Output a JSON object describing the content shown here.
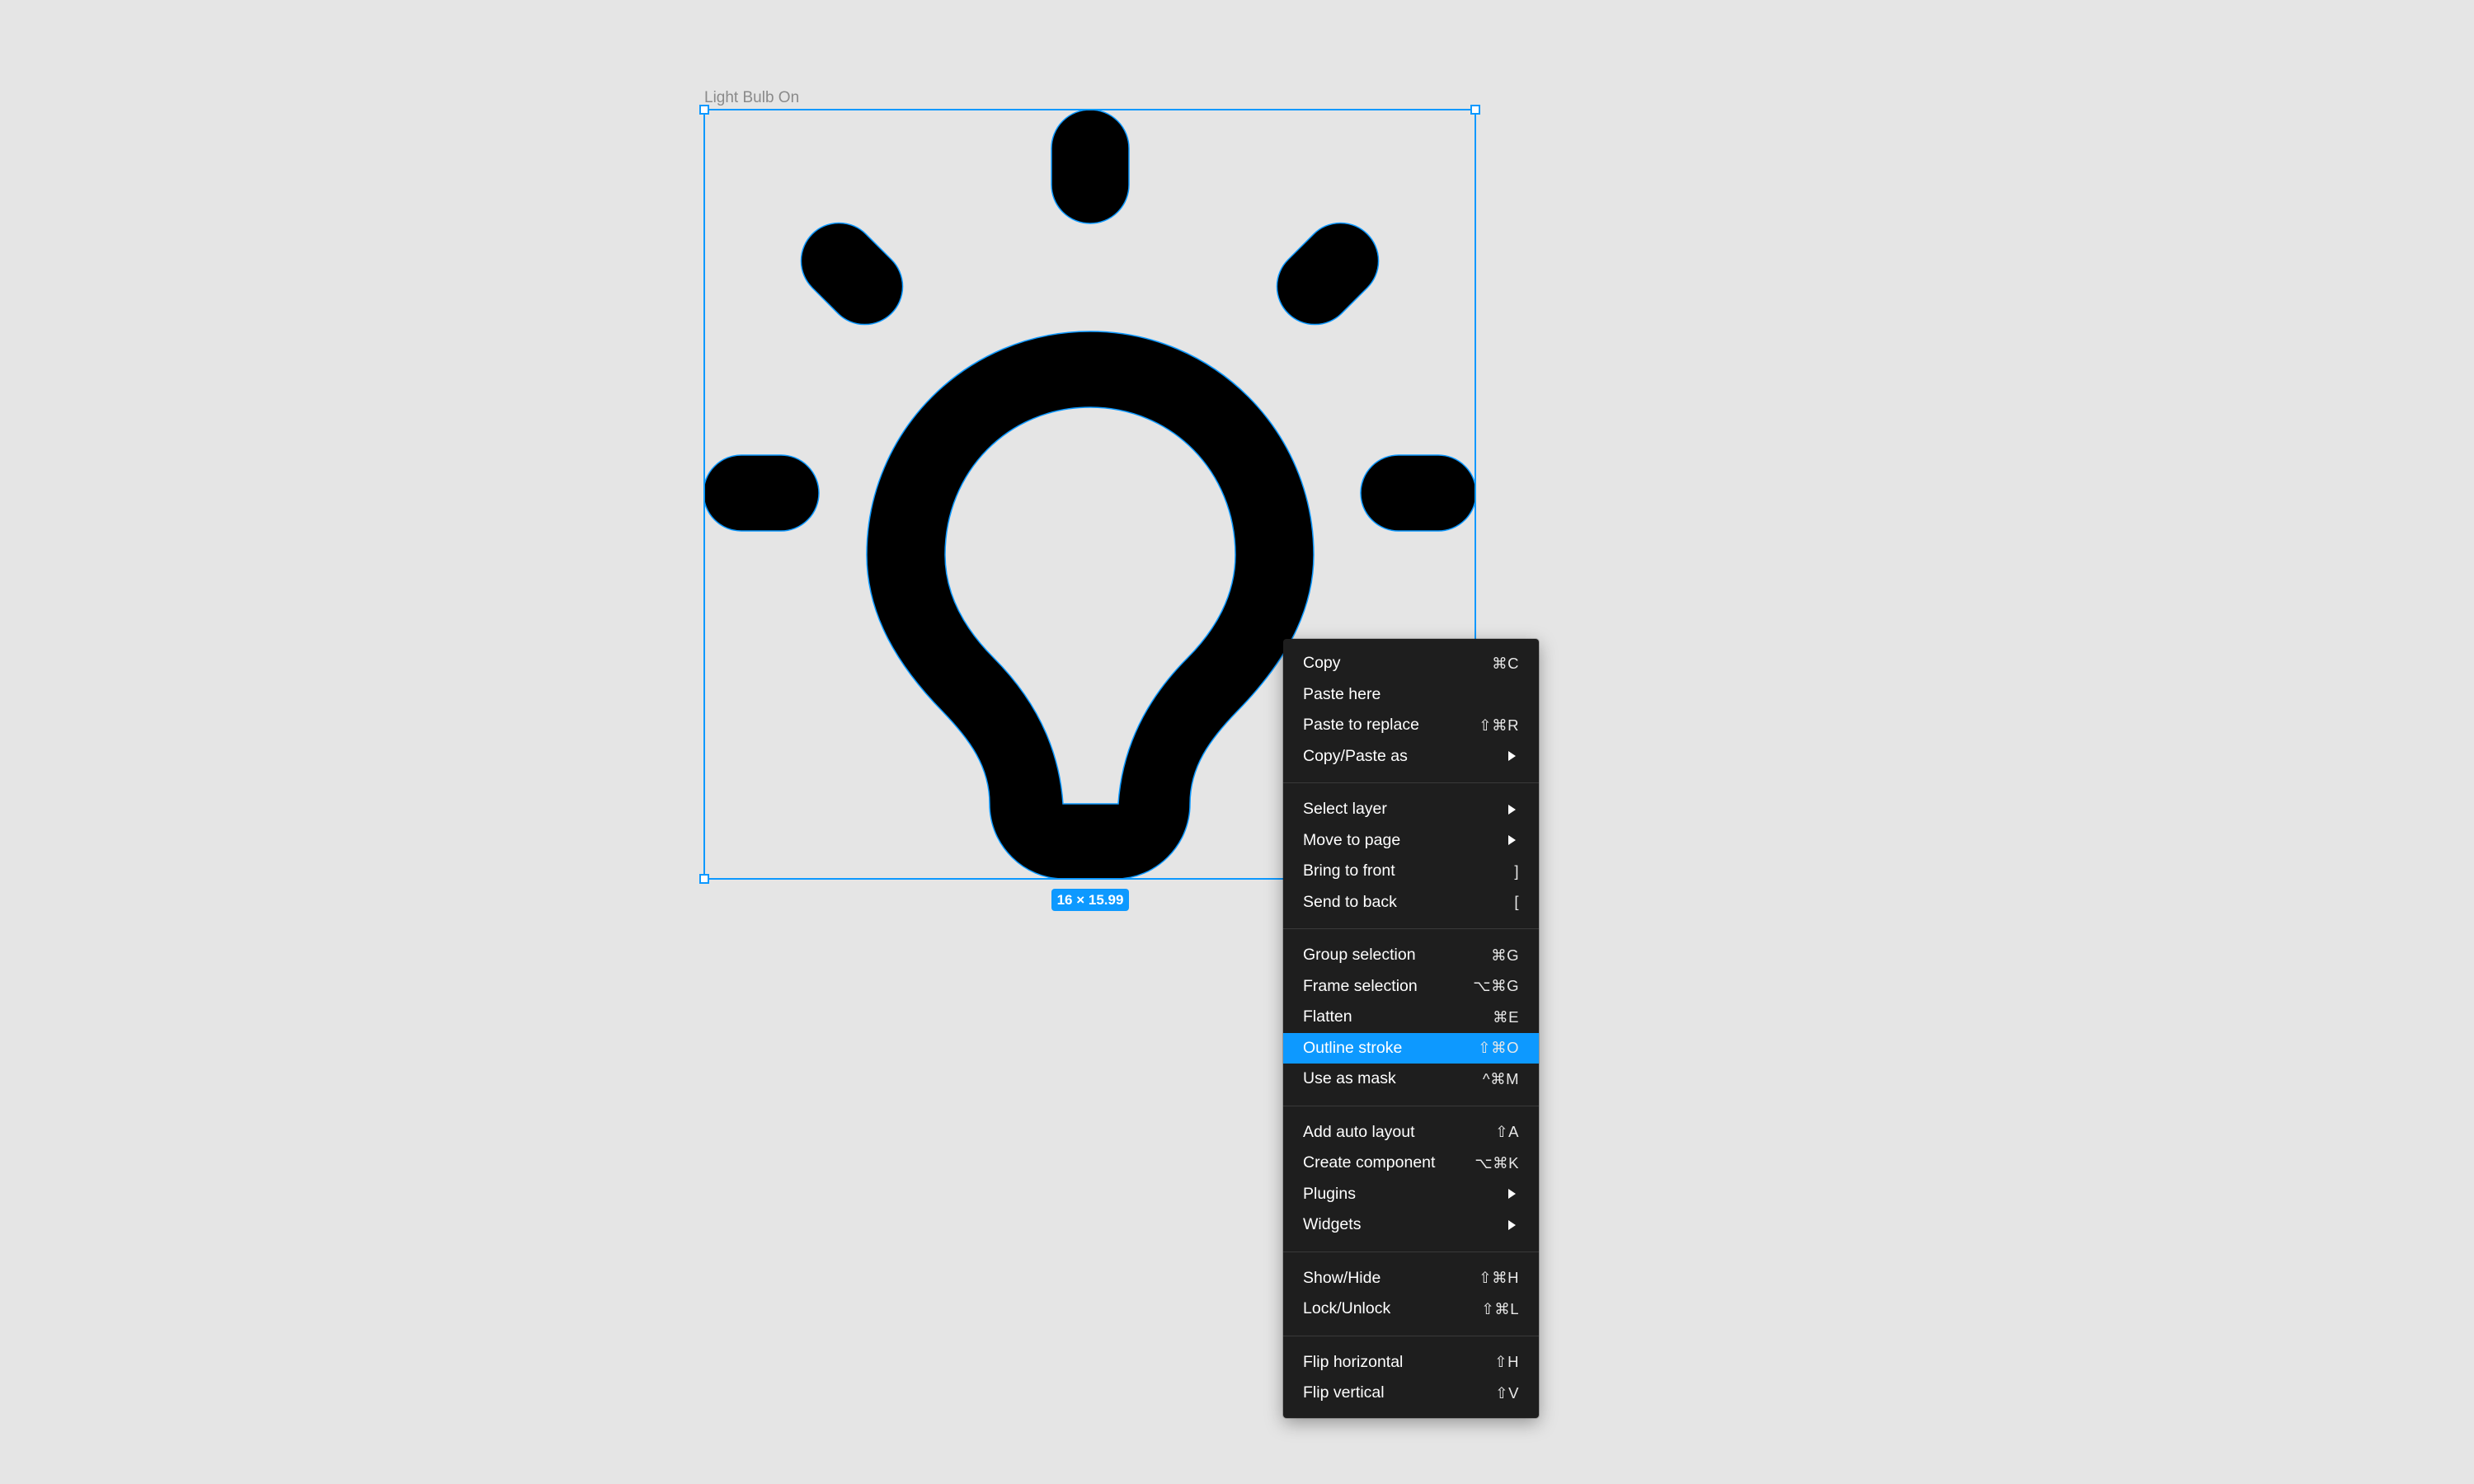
{
  "canvas": {
    "background": "#e5e5e5",
    "frame_label": "Light Bulb On",
    "dimensions": "16 × 15.99",
    "selection_color": "#0d99ff"
  },
  "icon": {
    "name": "light-bulb-on-icon",
    "fill": "#000000"
  },
  "context_menu": {
    "groups": [
      [
        {
          "label": "Copy",
          "shortcut": "⌘C"
        },
        {
          "label": "Paste here",
          "shortcut": ""
        },
        {
          "label": "Paste to replace",
          "shortcut": "⇧⌘R"
        },
        {
          "label": "Copy/Paste as",
          "submenu": true
        }
      ],
      [
        {
          "label": "Select layer",
          "submenu": true
        },
        {
          "label": "Move to page",
          "submenu": true
        },
        {
          "label": "Bring to front",
          "shortcut": "]"
        },
        {
          "label": "Send to back",
          "shortcut": "["
        }
      ],
      [
        {
          "label": "Group selection",
          "shortcut": "⌘G"
        },
        {
          "label": "Frame selection",
          "shortcut": "⌥⌘G"
        },
        {
          "label": "Flatten",
          "shortcut": "⌘E"
        },
        {
          "label": "Outline stroke",
          "shortcut": "⇧⌘O",
          "active": true
        },
        {
          "label": "Use as mask",
          "shortcut": "^⌘M"
        }
      ],
      [
        {
          "label": "Add auto layout",
          "shortcut": "⇧A"
        },
        {
          "label": "Create component",
          "shortcut": "⌥⌘K"
        },
        {
          "label": "Plugins",
          "submenu": true
        },
        {
          "label": "Widgets",
          "submenu": true
        }
      ],
      [
        {
          "label": "Show/Hide",
          "shortcut": "⇧⌘H"
        },
        {
          "label": "Lock/Unlock",
          "shortcut": "⇧⌘L"
        }
      ],
      [
        {
          "label": "Flip horizontal",
          "shortcut": "⇧H"
        },
        {
          "label": "Flip vertical",
          "shortcut": "⇧V"
        }
      ]
    ],
    "active_color": "#0d99ff"
  }
}
